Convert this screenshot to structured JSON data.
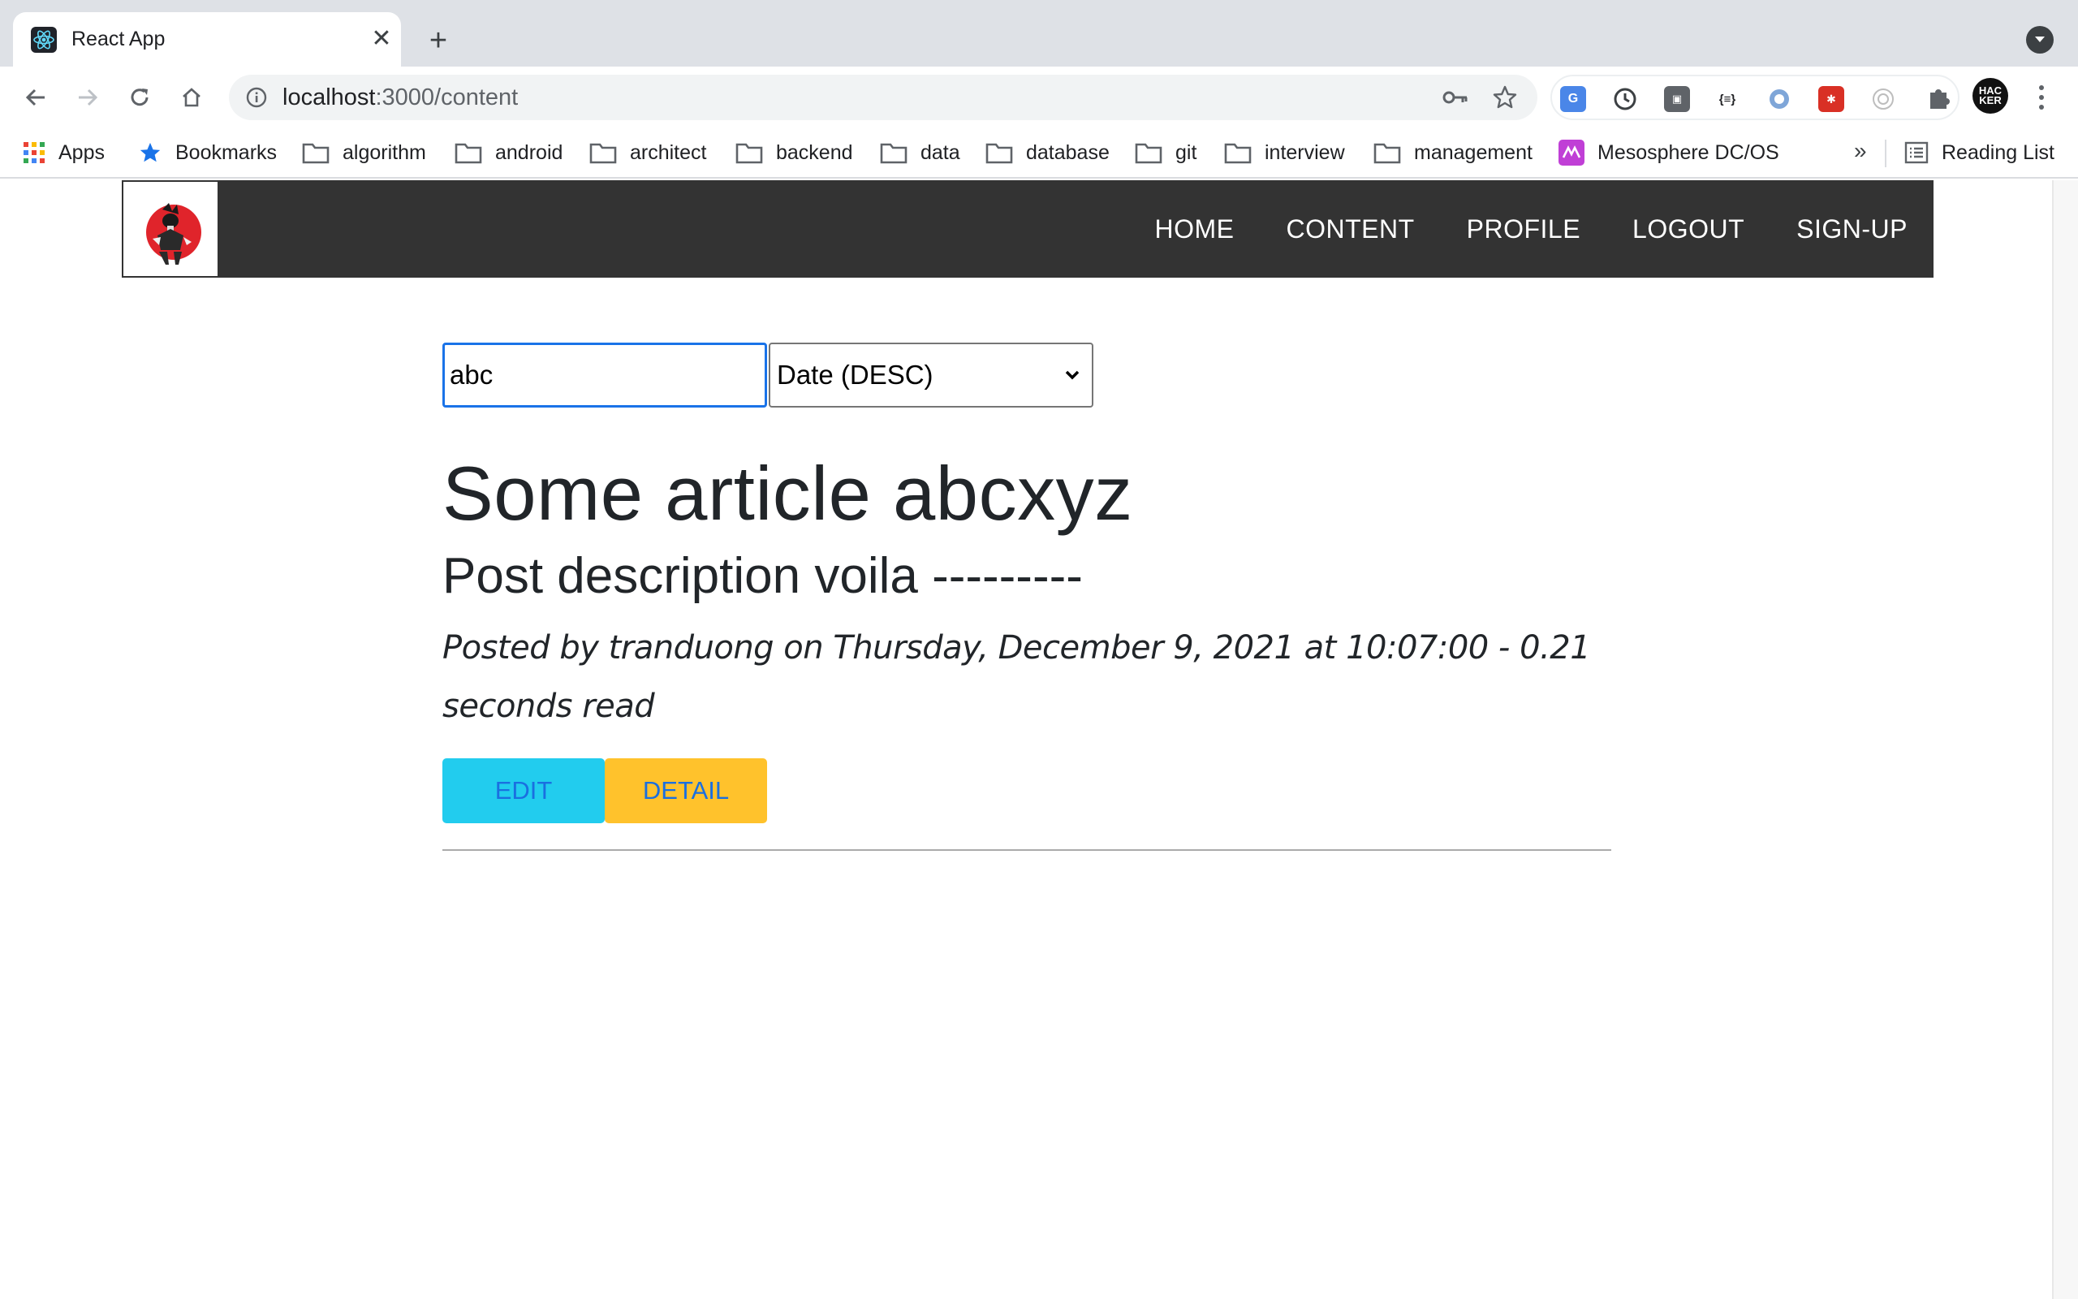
{
  "browser": {
    "tab_title": "React App",
    "url_host": "localhost",
    "url_path": ":3000/content",
    "bookmarks": {
      "apps": "Apps",
      "bookmarks": "Bookmarks",
      "folders": [
        "algorithm",
        "android",
        "architect",
        "backend",
        "data",
        "database",
        "git",
        "interview",
        "management"
      ],
      "mesosphere": "Mesosphere DC/OS",
      "more": "»",
      "reading_list": "Reading List"
    },
    "profile_initials": "HAC KER"
  },
  "nav": {
    "links": [
      "HOME",
      "CONTENT",
      "PROFILE",
      "LOGOUT",
      "SIGN-UP"
    ]
  },
  "filters": {
    "search_value": "abc",
    "sort_selected": "Date (DESC)"
  },
  "article": {
    "title": "Some article abcxyz",
    "description": "Post description voila ---------",
    "meta": "Posted by tranduong on Thursday, December 9, 2021 at 10:07:00 - 0.21 seconds read",
    "edit_label": "EDIT",
    "detail_label": "DETAIL"
  },
  "colors": {
    "nav_bg": "#333333",
    "edit_bg": "#22ccee",
    "detail_bg": "#ffc22c",
    "button_text": "#1a6fe0",
    "focus_border": "#1a73e8"
  }
}
